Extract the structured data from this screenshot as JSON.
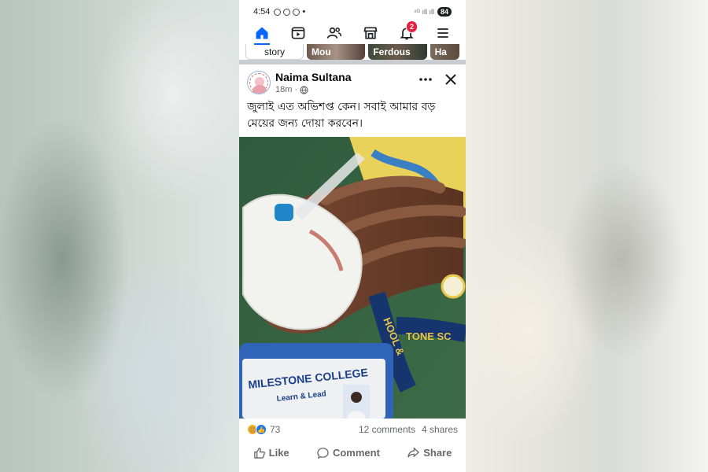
{
  "status_bar": {
    "time": "4:54",
    "battery": "84"
  },
  "nav": {
    "items": [
      {
        "name": "home"
      },
      {
        "name": "video"
      },
      {
        "name": "friends"
      },
      {
        "name": "marketplace"
      },
      {
        "name": "notifications",
        "badge": "2"
      },
      {
        "name": "menu"
      }
    ]
  },
  "stories": {
    "create_label": "story",
    "items": [
      {
        "name": "Mou"
      },
      {
        "name": "Ferdous"
      },
      {
        "name": "Ha"
      }
    ]
  },
  "post": {
    "author": "Naima Sultana",
    "time": "18m",
    "text_line1": "জুলাই এত অভিশপ্ত কেন। সবাই আমার বড়",
    "text_line2": "মেয়ের জন্য দোয়া করবেন।",
    "image": {
      "id_card_college": "MILESTONE COLLEGE",
      "id_card_motto": "Learn & Lead",
      "lanyard_text1": "HOOL &",
      "lanyard_text2": "TONE SC"
    },
    "reaction_count": "73",
    "comments": "12 comments",
    "shares": "4 shares",
    "actions": {
      "like": "Like",
      "comment": "Comment",
      "share": "Share"
    }
  },
  "colors": {
    "accent": "#0866ff",
    "badge": "#e41e3f",
    "text": "#050505",
    "secondary_text": "#65676b"
  }
}
